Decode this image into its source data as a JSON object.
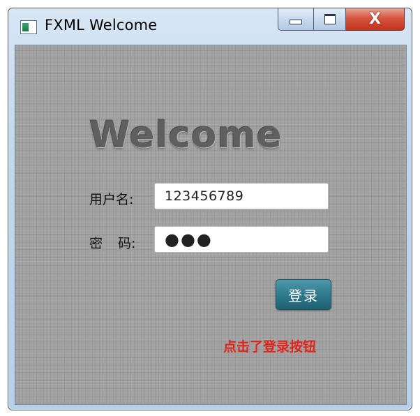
{
  "window": {
    "title": "FXML Welcome",
    "close_glyph": "X"
  },
  "form": {
    "heading": "Welcome",
    "username_label": "用户名:",
    "username_value": "123456789",
    "password_label_a": "密",
    "password_label_b": "码:",
    "password_mask": "●●●",
    "login_button": "登录",
    "status_message": "点击了登录按钮"
  },
  "colors": {
    "background": "#a2a2a2",
    "button": "#2f7a8c",
    "status_text": "#e0241a"
  },
  "icons": [
    "app-icon",
    "minimize-icon",
    "maximize-icon",
    "close-icon"
  ]
}
